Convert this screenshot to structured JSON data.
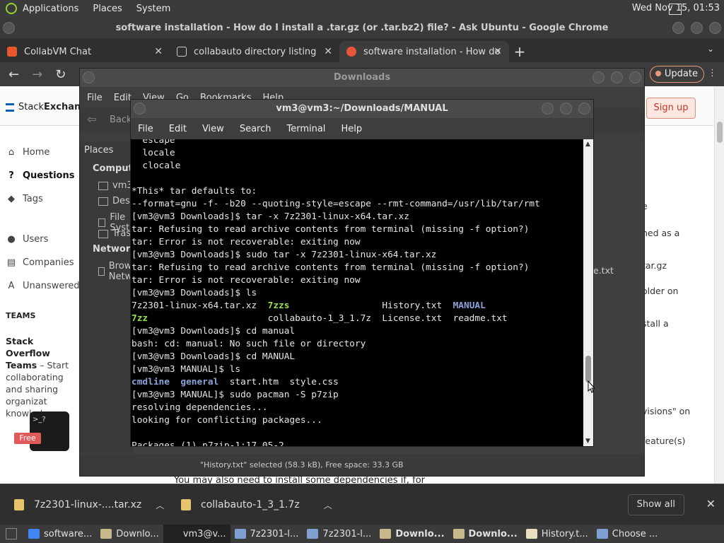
{
  "top_panel": {
    "menus": [
      "Applications",
      "Places",
      "System"
    ],
    "clock": "Wed Nov 15, 01:53"
  },
  "chrome": {
    "title": "software installation - How do I install a .tar.gz (or .tar.bz2) file? - Ask Ubuntu - Google Chrome",
    "tabs": [
      {
        "label": "CollabVM Chat",
        "close": "✕"
      },
      {
        "label": "collabauto directory listing",
        "close": "✕"
      },
      {
        "label": "software installation - How do",
        "close": "✕"
      }
    ],
    "new_tab": "+",
    "tab_list": "⌄",
    "update_label": "Update"
  },
  "page": {
    "logo_a": "Stack",
    "logo_b": "Exchange",
    "signup": "Sign up",
    "nav": [
      {
        "label": "Home",
        "icon": "⌂"
      },
      {
        "label": "Questions",
        "icon": "?"
      },
      {
        "label": "Tags",
        "icon": "◆"
      },
      {
        "label": "Users",
        "icon": "●"
      },
      {
        "label": "Companies",
        "icon": "▤"
      },
      {
        "label": "Unanswered",
        "icon": "A"
      }
    ],
    "teams_heading": "TEAMS",
    "teams_title": "Stack Overflow Teams",
    "teams_text": " – Start collaborating and sharing organizat knowledge.",
    "free_badge": "Free",
    "term_prompt": ">_?",
    "right_fragments": [
      "e",
      "ned as a",
      "tar.gz",
      "older on",
      "stall a",
      "visions\" on",
      " feature(s)"
    ],
    "bottom_text": "You may also need to install some dependencies if, for"
  },
  "file_manager": {
    "title": "Downloads",
    "menus": [
      "File",
      "Edit",
      "View",
      "Go",
      "Bookmarks",
      "Help"
    ],
    "back": "Back",
    "places_header": "Places",
    "sections": [
      "Computer",
      "Network"
    ],
    "side_items": [
      "vm3",
      "Desktop",
      "File System",
      "Trash",
      "Browse Network"
    ],
    "frag_txt": "e.txt",
    "status": "\"History.txt\" selected (58.3 kB), Free space: 33.3 GB"
  },
  "terminal": {
    "title": "vm3@vm3:~/Downloads/MANUAL",
    "menus": [
      "File",
      "Edit",
      "View",
      "Search",
      "Terminal",
      "Help"
    ],
    "lines": [
      [
        {
          "t": "  escape"
        }
      ],
      [
        {
          "t": "  locale"
        }
      ],
      [
        {
          "t": "  clocale"
        }
      ],
      [
        {
          "t": ""
        }
      ],
      [
        {
          "t": "*This* tar defaults to:"
        }
      ],
      [
        {
          "t": "--format=gnu -f- -b20 --quoting-style=escape --rmt-command=/usr/lib/tar/rmt"
        }
      ],
      [
        {
          "t": "[vm3@vm3 Downloads]$ tar -x 7z2301-linux-x64.tar.xz"
        }
      ],
      [
        {
          "t": "tar: Refusing to read archive contents from terminal (missing -f option?)"
        }
      ],
      [
        {
          "t": "tar: Error is not recoverable: exiting now"
        }
      ],
      [
        {
          "t": "[vm3@vm3 Downloads]$ sudo tar -x 7z2301-linux-x64.tar.xz"
        }
      ],
      [
        {
          "t": "tar: Refusing to read archive contents from terminal (missing -f option?)"
        }
      ],
      [
        {
          "t": "tar: Error is not recoverable: exiting now"
        }
      ],
      [
        {
          "t": "[vm3@vm3 Downloads]$ ls"
        }
      ],
      [
        {
          "t": "7z2301-linux-x64.tar.xz  "
        },
        {
          "t": "7zzs",
          "c": "exe"
        },
        {
          "t": "                 History.txt  "
        },
        {
          "t": "MANUAL",
          "c": "dir"
        }
      ],
      [
        {
          "t": "7zz",
          "c": "exe"
        },
        {
          "t": "                      collabauto-1_3_1.7z  License.txt  readme.txt"
        }
      ],
      [
        {
          "t": "[vm3@vm3 Downloads]$ cd manual"
        }
      ],
      [
        {
          "t": "bash: cd: manual: No such file or directory"
        }
      ],
      [
        {
          "t": "[vm3@vm3 Downloads]$ cd MANUAL"
        }
      ],
      [
        {
          "t": "[vm3@vm3 MANUAL]$ ls"
        }
      ],
      [
        {
          "t": "cmdline",
          "c": "dir"
        },
        {
          "t": "  "
        },
        {
          "t": "general",
          "c": "dir"
        },
        {
          "t": "  start.htm  style.css"
        }
      ],
      [
        {
          "t": "[vm3@vm3 MANUAL]$ sudo pacman -S p7zip"
        }
      ],
      [
        {
          "t": "resolving dependencies..."
        }
      ],
      [
        {
          "t": "looking for conflicting packages..."
        }
      ],
      [
        {
          "t": ""
        }
      ],
      [
        {
          "t": "Packages (1) p7zip-1:17.05-2"
        }
      ]
    ]
  },
  "downloads": {
    "items": [
      "7z2301-linux-....tar.xz",
      "collabauto-1_3_1.7z"
    ],
    "show_all": "Show all"
  },
  "taskbar": {
    "items": [
      {
        "label": "software...",
        "bold": false,
        "color": "#4285f4"
      },
      {
        "label": "Downlo...",
        "bold": false,
        "color": "#c8b98a"
      },
      {
        "label": "vm3@v...",
        "bold": false,
        "color": "#222222",
        "active": true
      },
      {
        "label": "7z2301-l...",
        "bold": false,
        "color": "#7fa0d0"
      },
      {
        "label": "7z2301-l...",
        "bold": false,
        "color": "#7fa0d0"
      },
      {
        "label": "Downlo...",
        "bold": true,
        "color": "#c8b98a"
      },
      {
        "label": "Downlo...",
        "bold": true,
        "color": "#c8b98a"
      },
      {
        "label": "History.t...",
        "bold": false,
        "color": "#e8e0c0"
      },
      {
        "label": "Choose ...",
        "bold": false,
        "color": "#7fa0d0"
      }
    ]
  },
  "colors": {
    "panel": "#3b3b3b",
    "terminal_bg": "#000000",
    "dir": "#8aa2d8",
    "exe": "#9be24a",
    "accent": "#e9967a"
  }
}
